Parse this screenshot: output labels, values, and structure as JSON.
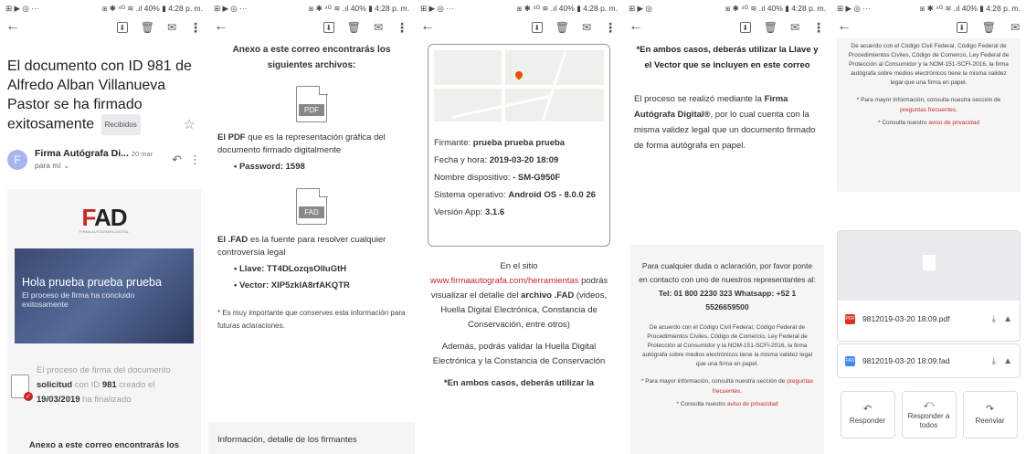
{
  "status": {
    "p1_left": "⊞ ▶ ◎ ···",
    "p1_right": "⧆ ✱ ⁴ᴳ ≋ .ıl 40% ▮ 4:28 p. m.",
    "p2_left": "⊞ ▶ ◎ ···",
    "p2_right": "⧆ ✱ ⁴ᴳ ≋ .ıl 40% ▮ 4:28 p. m.",
    "p3_left": "⊞ ▶ ◎ ···",
    "p3_right": "⧆ ✱ ⁴ᴳ ≋ .ıl 40% ▮ 4:28 p. m.",
    "p4_left": "⊞ ▶ ◎",
    "p4_right": "⧆ ✱ ⁴ᴳ ≋ .ıl 40% ▮ 4:28 p. m.",
    "p5_left": "⊞ ▶ ◎ ···",
    "p5_right": "⧆ ✱ ⁴ᴳ ≋ .ıl 40% ▮ 4:28 p. m."
  },
  "icons": {
    "back": "←",
    "archive": "⬇",
    "delete": "🗑",
    "mail": "✉",
    "more": "⋮",
    "star": "☆",
    "reply": "↶",
    "reply_all": "⤺",
    "forward": "↷",
    "download": "⤓",
    "drive": "▲"
  },
  "panel1": {
    "subject": "El documento con ID 981 de Alfredo Alban Villanueva Pastor se ha firmado exitosamente",
    "badge": "Recibidos",
    "avatar_letter": "F",
    "sender_name": "Firma Autógrafa Di...",
    "sender_date": "20 mar",
    "sender_to": "para mí ⌄",
    "logo_mark": "F",
    "logo_rest": "AD",
    "logo_sub": "FIRMA AUTÓGRAFA DIGITAL",
    "hero_title": "Hola prueba prueba prueba",
    "hero_sub1": "El proceso de firma ha concluido",
    "hero_sub2": "exitosamente",
    "proc_1": "El proceso de firma del documento",
    "proc_2a": "solicitud",
    "proc_2b": " con ID ",
    "proc_2c": "981",
    "proc_2d": " creado el",
    "proc_3a": "19/03/2019",
    "proc_3b": " ha finalizado",
    "cut_text": "Anexo a este correo encontrarás los"
  },
  "panel2": {
    "intro": "Anexo a este correo encontrarás los siguientes archivos:",
    "pdf_label": "PDF",
    "pdf_desc_b": "El PDF",
    "pdf_desc": " que es la representación gráfica del documento firmado digitalmente",
    "password": "• Password: 1598",
    "fad_label": "FAD",
    "fad_desc_b": "El .FAD",
    "fad_desc": " es la fuente para resolver cualquier controversia legal",
    "llave": "• Llave: TT4DLozqsOlluGtH",
    "vector": "• Vector: XIP5zkIA8rfAKQTR",
    "note": "* Es muy importante que conserves esta información para futuras aclaraciones.",
    "footer": "Información, detalle de los firmantes"
  },
  "panel3": {
    "firmante_l": "Firmante: ",
    "firmante_v": "prueba prueba prueba",
    "fecha_l": "Fecha y hora: ",
    "fecha_v": "2019-03-20 18:09",
    "disp_l": "Nombre dispositivo: ",
    "disp_v": "- SM-G950F",
    "so_l": "Sistema operativo: ",
    "so_v": "Android OS - 8.0.0 26",
    "ver_l": "Versión App: ",
    "ver_v": "3.1.6",
    "site_pre": "En el sitio ",
    "site_link": "www.firmaautografa.com/herramientas",
    "site_post": " podrás visualizar el detalle del ",
    "site_b": "archivo .FAD",
    "site_end": " (videos, Huella Digital Electrónica, Constancia de Conservación, entre otros)",
    "valid": "Además, podrás validar la Huella Digital Electrónica y la Constancia de Conservación",
    "ambos": "*En ambos casos, deberás utilizar la"
  },
  "panel4": {
    "ambos": "*En ambos casos, deberás utilizar la Llave y el Vector que se incluyen en este correo",
    "proceso_pre": "El proceso se realizó mediante la ",
    "proceso_b": "Firma Autógrafa Digital®",
    "proceso_post": ", por lo cual cuenta con la misma validez legal que un documento firmado de forma autógrafa en papel.",
    "contact_pre": "Para cualquier duda o aclaración, por favor ponte en contacto con uno de nuestros representantes al: ",
    "tel": "Tel: 01 800 2230 323",
    "whatsapp": "Whatsapp: +52 1 5526659500",
    "legal": "De acuerdo con el Código Civil Federal, Código Federal de Procedimientos Civiles, Código de Comercio, Ley Federal de Protección al Consumidor y la NOM-151-SCFI-2016, la firma autógrafa sobre medios electrónicos tiene la misma validez legal que una firma en papel.",
    "note1_pre": "* Para mayor información, consulta nuestra sección de ",
    "note1_link": "preguntas frecuentes.",
    "note2_pre": "* Consulta nuestro ",
    "note2_link": "aviso de privacidad"
  },
  "panel5": {
    "legal": "De acuerdo con el Código Civil Federal, Código Federal de Procedimientos Civiles, Código de Comercio, Ley Federal de Protección al Consumidor y la NOM-151-SCFI-2016, la firma autógrafa sobre medios electrónicos tiene la misma validez legal que una firma en papel.",
    "note1_pre": "* Para mayor información, consulta nuestra sección de ",
    "note1_link": "preguntas frecuentes.",
    "note2_pre": "* Consulta nuestro ",
    "note2_link": "aviso de privacidad",
    "att1_type": "PDF",
    "att1_name": "9812019-03-20 18:09.pdf",
    "att2_type": "FAD",
    "att2_name": "9812019-03-20 18:09.fad",
    "reply": "Responder",
    "reply_all": "Responder a todos",
    "forward": "Reenviar"
  },
  "colors": {
    "accent_red": "#c62828",
    "pdf_red": "#d93025",
    "fad_blue": "#4285f4",
    "hero": "#3b4a73"
  }
}
